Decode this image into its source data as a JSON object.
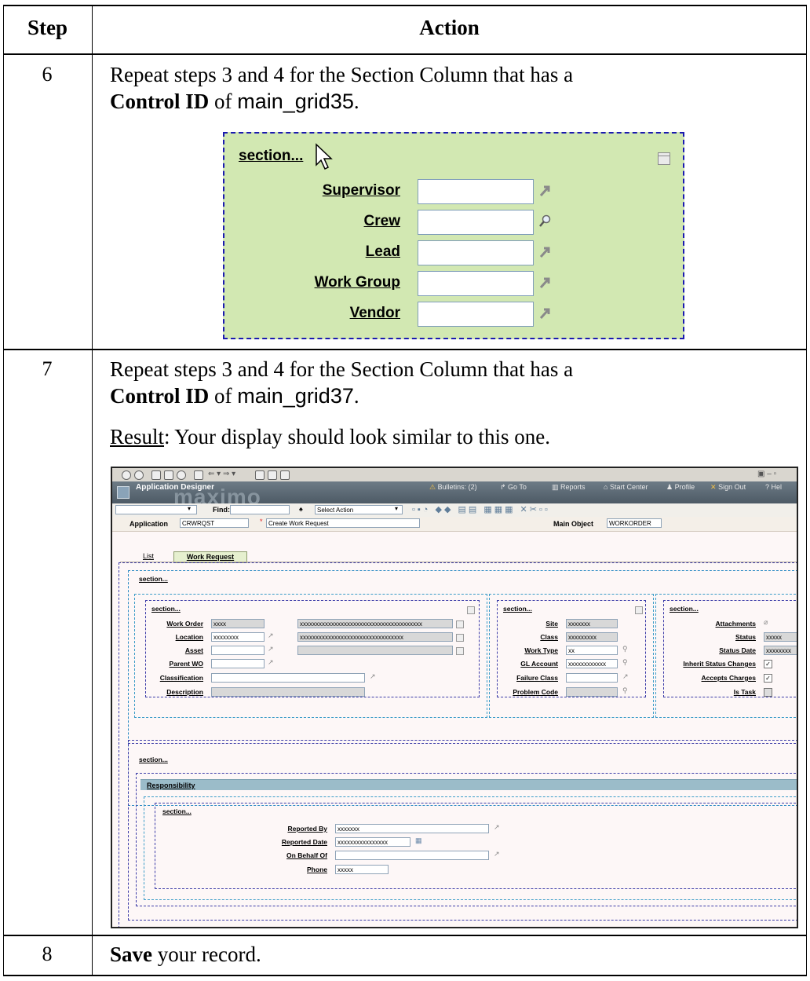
{
  "table": {
    "header_step": "Step",
    "header_action": "Action"
  },
  "step6": {
    "number": "6",
    "line1": "Repeat steps 3 and 4 for the Section Column that has a",
    "control_id_label": "Control ID",
    "of": " of ",
    "control_id_value": "main_grid35",
    "period": ".",
    "figure": {
      "section_label": "section...",
      "fields": [
        "Supervisor",
        "Crew",
        "Lead",
        "Work Group",
        "Vendor"
      ],
      "field_icons": [
        "arrow-icon",
        "magnifier-icon",
        "arrow-icon",
        "arrow-icon",
        "arrow-icon"
      ]
    }
  },
  "step7": {
    "number": "7",
    "line1": "Repeat steps 3 and 4 for the Section Column that has a",
    "control_id_label": "Control ID",
    "of": " of ",
    "control_id_value": "main_grid37",
    "period": ".",
    "result_label": "Result",
    "result_text": ": Your display should look similar to this one."
  },
  "step8": {
    "number": "8",
    "save_bold": "Save",
    "rest": " your record."
  },
  "maximo": {
    "app_title": "Application Designer",
    "logo": "maximo",
    "nav": {
      "bulletins": "Bulletins: (2)",
      "goto": "Go To",
      "reports": "Reports",
      "start_center": "Start Center",
      "profile": "Profile",
      "sign_out": "Sign Out",
      "help": "Hel"
    },
    "find_label": "Find:",
    "select_action": "Select Action",
    "application_label": "Application",
    "application_value": "CRWRQST",
    "app_desc_value": "Create Work Request",
    "main_object_label": "Main Object",
    "main_object_value": "WORKORDER",
    "tabs": [
      "List",
      "Work Request"
    ],
    "section_label": "section...",
    "col1": {
      "fields": [
        "Work Order",
        "Location",
        "Asset",
        "Parent WO",
        "Classification",
        "Description"
      ],
      "values": [
        "xxxx",
        "xxxxxxxx",
        "",
        "",
        "",
        ""
      ],
      "long_values": [
        "xxxxxxxxxxxxxxxxxxxxxxxxxxxxxxxxxxxxxxx",
        "xxxxxxxxxxxxxxxxxxxxxxxxxxxxxxxxx",
        ""
      ]
    },
    "col2": {
      "fields": [
        "Site",
        "Class",
        "Work Type",
        "GL Account",
        "Failure Class",
        "Problem Code"
      ],
      "values": [
        "xxxxxxx",
        "xxxxxxxxx",
        "xx",
        "xxxxxxxxxxxx",
        "",
        ""
      ]
    },
    "col3": {
      "fields": [
        "Attachments",
        "Status",
        "Status Date",
        "Inherit Status Changes",
        "Accepts Charges",
        "Is Task"
      ],
      "values": [
        "",
        "xxxxx",
        "xxxxxxxx",
        "",
        "",
        ""
      ]
    },
    "responsibility_label": "Responsibility",
    "resp": {
      "fields": [
        "Reported By",
        "Reported Date",
        "On Behalf Of",
        "Phone"
      ],
      "values": [
        "xxxxxxx",
        "xxxxxxxxxxxxxxxx",
        "",
        "xxxxx"
      ]
    }
  }
}
